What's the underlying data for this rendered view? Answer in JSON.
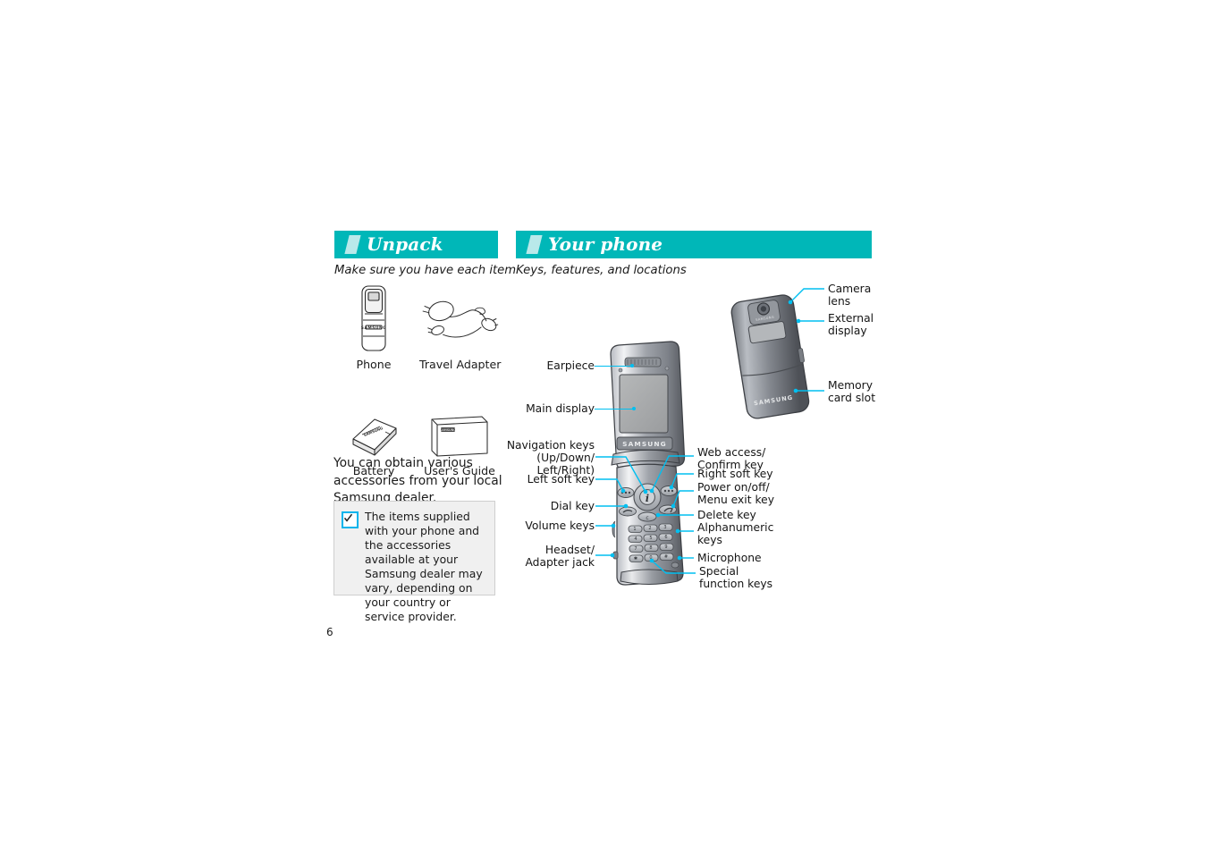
{
  "page": {
    "number": "6"
  },
  "sections": {
    "unpack": {
      "title": "Unpack",
      "subtitle": "Make sure you have each item",
      "items": [
        {
          "caption": "Phone",
          "icon": "phone-illustration"
        },
        {
          "caption": "Travel Adapter",
          "icon": "travel-adapter-illustration"
        },
        {
          "caption": "Battery",
          "icon": "battery-illustration"
        },
        {
          "caption": "User's Guide",
          "icon": "users-guide-illustration"
        }
      ],
      "body": "You can obtain various accessories from your local Samsung dealer.",
      "note": {
        "icon": "checkbox-checked-icon",
        "text": "The items supplied with your phone and the accessories available at your Samsung dealer may vary, depending on your country or service provider."
      }
    },
    "your_phone": {
      "title": "Your phone",
      "subtitle": "Keys, features, and locations",
      "front_labels": {
        "earpiece": "Earpiece",
        "main_display": "Main display",
        "navigation_keys": "Navigation keys\n(Up/Down/\nLeft/Right)",
        "navigation_keys_l1": "Navigation keys",
        "navigation_keys_l2": "(Up/Down/",
        "navigation_keys_l3": "Left/Right)",
        "left_soft_key": "Left soft key",
        "dial_key": "Dial key",
        "volume_keys": "Volume keys",
        "headset_jack_l1": "Headset/",
        "headset_jack_l2": "Adapter jack",
        "web_access_l1": "Web access/",
        "web_access_l2": "Confirm key",
        "right_soft_key": "Right soft key",
        "power_key_l1": "Power on/off/",
        "power_key_l2": "Menu exit key",
        "delete_key": "Delete key",
        "alphanumeric_l1": "Alphanumeric",
        "alphanumeric_l2": "keys",
        "microphone": "Microphone",
        "special_keys_l1": "Special",
        "special_keys_l2": "function keys"
      },
      "back_labels": {
        "camera_lens_l1": "Camera",
        "camera_lens_l2": "lens",
        "external_display_l1": "External",
        "external_display_l2": "display",
        "memory_card_l1": "Memory",
        "memory_card_l2": "card slot"
      },
      "brand": "SAMSUNG",
      "keypad": [
        "1",
        "2",
        "3",
        "4",
        "5",
        "6",
        "7",
        "8",
        "9",
        "✱",
        "0",
        "#"
      ]
    }
  },
  "colors": {
    "band": "#00b7b8",
    "band_slash": "#b9e9ea",
    "leader": "#00bff0",
    "note_bg": "#f0f0f0",
    "check_border": "#00b4ec",
    "text": "#1b1b1b"
  }
}
